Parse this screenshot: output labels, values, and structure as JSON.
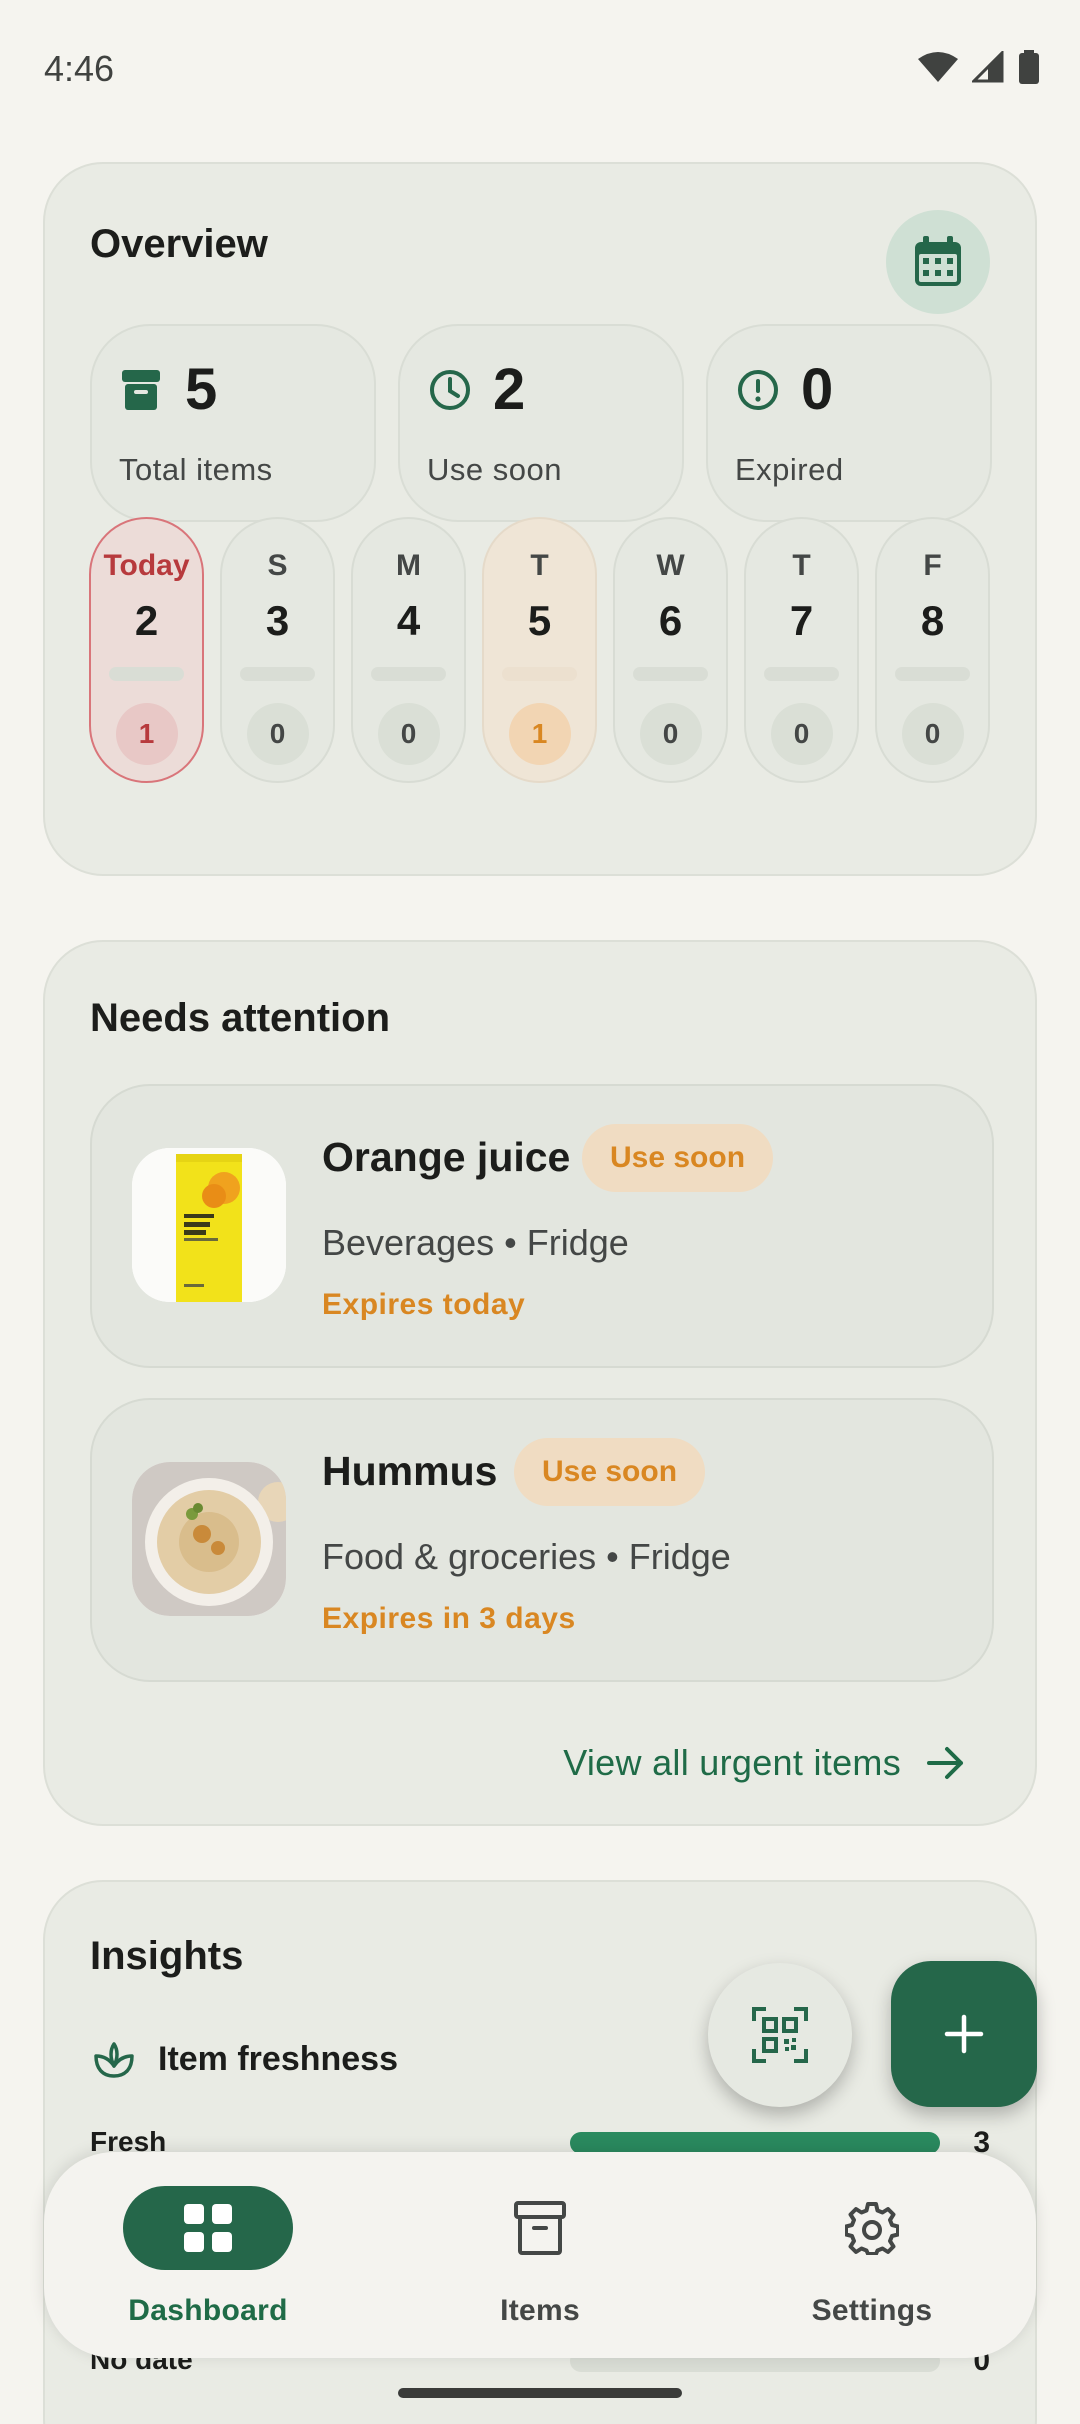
{
  "status_bar": {
    "time": "4:46"
  },
  "overview": {
    "title": "Overview",
    "stats": [
      {
        "icon": "archive-icon",
        "value": "5",
        "label": "Total items"
      },
      {
        "icon": "clock-icon",
        "value": "2",
        "label": "Use soon"
      },
      {
        "icon": "alert-circle-icon",
        "value": "0",
        "label": "Expired"
      }
    ],
    "days": [
      {
        "label": "Today",
        "date": "2",
        "count": "1",
        "state": "today"
      },
      {
        "label": "S",
        "date": "3",
        "count": "0",
        "state": "normal"
      },
      {
        "label": "M",
        "date": "4",
        "count": "0",
        "state": "normal"
      },
      {
        "label": "T",
        "date": "5",
        "count": "1",
        "state": "soon"
      },
      {
        "label": "W",
        "date": "6",
        "count": "0",
        "state": "normal"
      },
      {
        "label": "T",
        "date": "7",
        "count": "0",
        "state": "normal"
      },
      {
        "label": "F",
        "date": "8",
        "count": "0",
        "state": "normal"
      }
    ]
  },
  "attention": {
    "title": "Needs attention",
    "items": [
      {
        "name": "Orange juice",
        "badge": "Use soon",
        "meta": "Beverages • Fridge",
        "expiry": "Expires today"
      },
      {
        "name": "Hummus",
        "badge": "Use soon",
        "meta": "Food & groceries • Fridge",
        "expiry": "Expires in 3 days"
      }
    ],
    "view_all": "View all urgent items"
  },
  "insights": {
    "title": "Insights",
    "freshness_title": "Item freshness",
    "rows": [
      {
        "label": "Fresh",
        "value": "3",
        "fraction": 1.0
      },
      {
        "label": "No date",
        "value": "0",
        "fraction": 0.0
      }
    ]
  },
  "nav": {
    "items": [
      {
        "label": "Dashboard",
        "icon": "grid-icon",
        "active": true
      },
      {
        "label": "Items",
        "icon": "archive-icon",
        "active": false
      },
      {
        "label": "Settings",
        "icon": "gear-icon",
        "active": false
      }
    ]
  },
  "colors": {
    "accent": "#25674a",
    "warning": "#d98722",
    "danger": "#b73a3d",
    "background": "#f5f4ef"
  }
}
